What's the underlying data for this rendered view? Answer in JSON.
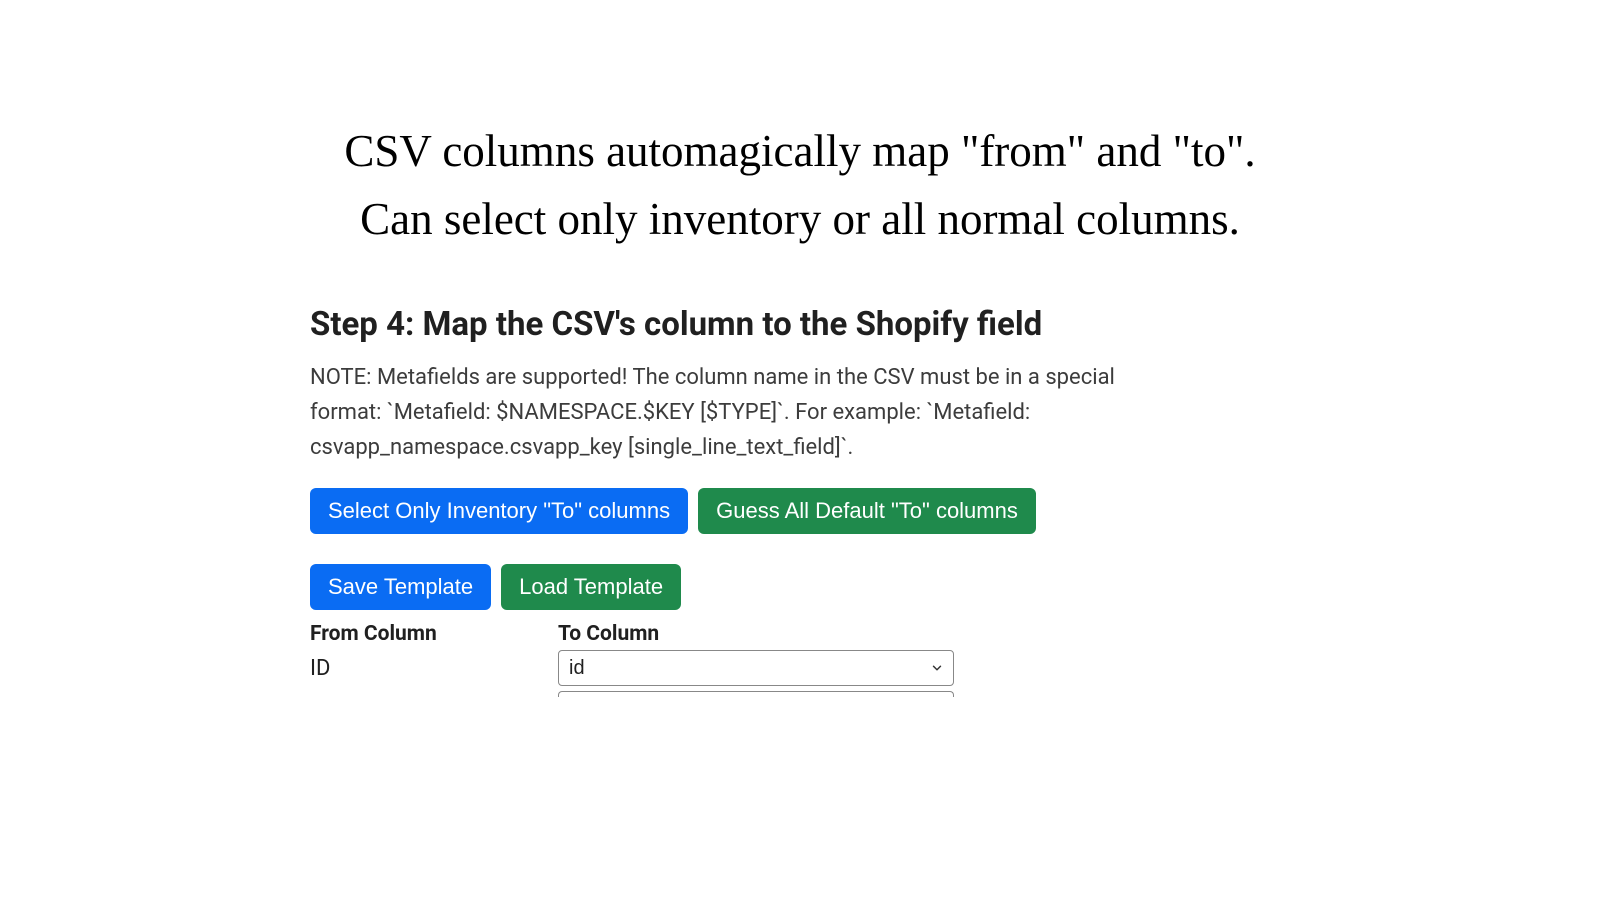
{
  "caption": {
    "line1": "CSV columns automagically map \"from\" and \"to\".",
    "line2": "Can select only inventory or all normal columns."
  },
  "step": {
    "title": "Step 4: Map the CSV's column to the Shopify field",
    "note": "NOTE: Metafields are supported! The column name in the CSV must be in a special format: `Metafield: $NAMESPACE.$KEY [$TYPE]`. For example: `Metafield: csvapp_namespace.csvapp_key [single_line_text_field]`."
  },
  "buttons": {
    "select_inventory": "Select Only Inventory \"To\" columns",
    "guess_all": "Guess All Default \"To\" columns",
    "save_template": "Save Template",
    "load_template": "Load Template"
  },
  "table": {
    "from_header": "From Column",
    "to_header": "To Column",
    "rows": [
      {
        "from": "ID",
        "to": "id"
      }
    ]
  },
  "colors": {
    "blue": "#0a6cf3",
    "green": "#1f8a4c"
  }
}
